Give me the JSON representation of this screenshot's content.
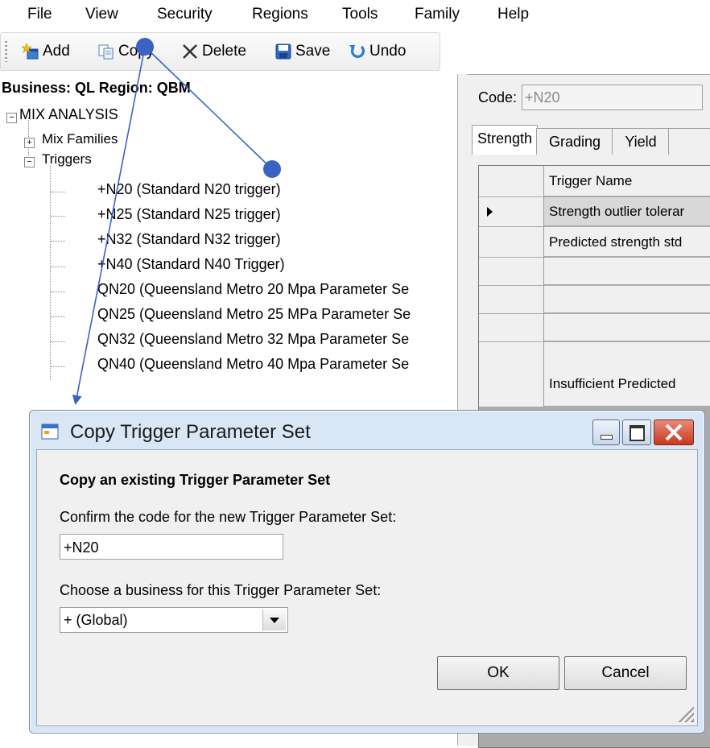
{
  "menu": [
    "File",
    "View",
    "Security",
    "Regions",
    "Tools",
    "Family",
    "Help"
  ],
  "toolbar": {
    "add": "Add",
    "copy": "Copy",
    "delete": "Delete",
    "save": "Save",
    "undo": "Undo"
  },
  "tree": {
    "header": "Business: QL  Region: QBM",
    "root": "MIX ANALYSIS",
    "mix_families": "Mix Families",
    "triggers": "Triggers",
    "trigger_items": [
      "+N20 (Standard N20 trigger)",
      "+N25 (Standard N25 trigger)",
      "+N32 (Standard N32 trigger)",
      "+N40 (Standard N40 Trigger)",
      "QN20 (Queensland Metro 20 Mpa Parameter Se",
      "QN25 (Queensland Metro 25 MPa Parameter Se",
      "QN32 (Queensland Metro 32 Mpa Parameter Se",
      "QN40 (Queensland Metro 40 Mpa Parameter Se"
    ]
  },
  "detail": {
    "code_label": "Code:",
    "code_value": "+N20",
    "tabs": [
      "Strength",
      "Grading",
      "Yield"
    ],
    "grid_header": "Trigger Name",
    "grid_rows": [
      "Strength outlier tolerar",
      "Predicted strength std",
      "",
      "",
      "",
      "Insufficient Predicted"
    ]
  },
  "dialog": {
    "title": "Copy Trigger Parameter Set",
    "heading": "Copy an existing Trigger Parameter Set",
    "code_prompt": "Confirm the code for the new Trigger Parameter Set:",
    "code_value": "+N20",
    "business_prompt": "Choose a business for this Trigger Parameter Set:",
    "business_value": "+ (Global)",
    "ok": "OK",
    "cancel": "Cancel"
  },
  "colors": {
    "annotation": "#3b63c4",
    "dialog_frame": "#d9e6f5",
    "close_button": "#c6391f"
  }
}
